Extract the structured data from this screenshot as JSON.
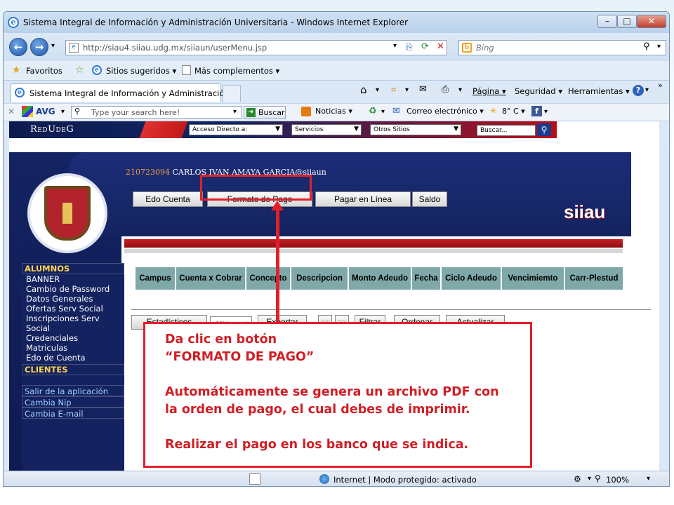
{
  "window": {
    "title": "Sistema Integral de Información y Administración Universitaria - Windows Internet Explorer"
  },
  "address": {
    "url": "http://siau4.siiau.udg.mx/siiaun/userMenu.jsp",
    "search_placeholder": "Bing"
  },
  "favorites": {
    "favoritos": "Favoritos",
    "sitios": "Sitios sugeridos ▾",
    "mas": "Más complementos ▾"
  },
  "tab": {
    "label": "Sistema Integral de Información y Administració..."
  },
  "commands": {
    "pagina": "Página ▾",
    "seguridad": "Seguridad ▾",
    "herramientas": "Herramientas ▾"
  },
  "avg": {
    "logo": "AVG",
    "search_placeholder": "Type your search here!",
    "buscar": "Buscar",
    "noticias": "Noticias ▾",
    "correo": "Correo electrónico ▾",
    "weather": "8° C ▾"
  },
  "site": {
    "brand": "RedUdeG",
    "selects": [
      "Acceso Directo a:",
      "Servicios",
      "Otros Sitios"
    ],
    "search": "Buscar...",
    "user_id": "210723094",
    "user_name": "CARLOS IVAN AMAYA GARCIA@siiaun",
    "siiau_logo": "siiau",
    "tabs": [
      "Edo Cuenta",
      "Formato de Pago",
      "Pagar en Línea",
      "Saldo"
    ]
  },
  "menu": {
    "alumnos": "ALUMNOS",
    "items": [
      "BANNER",
      "Cambio de Password",
      "Datos Generales",
      "Ofertas Serv Social",
      "Inscripciones Serv",
      "Social",
      "Credenciales",
      "Matriculas",
      "Edo de Cuenta"
    ],
    "clientes": "CLIENTES",
    "links": [
      "Salir de la aplicación",
      "Cambia Nip",
      "Cambia E-mail"
    ]
  },
  "table": {
    "headers": [
      "Campus",
      "Cuenta x Cobrar",
      "Concepto",
      "Descripcion",
      "Monto Adeudo",
      "Fecha",
      "Ciclo Adeudo",
      "Vencimiemto",
      "Carr-Plestud"
    ]
  },
  "toolbar": {
    "estadisticos": "Estadísticos",
    "format": "csv",
    "exportar": "Exportar",
    "prev": "<<",
    "next": ">>",
    "filtrar": "Filtrar",
    "ordenar": "Ordenar",
    "actualizar": "Actualizar"
  },
  "annotation": {
    "line1": "Da clic en botón",
    "line2": "“FORMATO DE PAGO”",
    "line3": "Automáticamente se genera un archivo PDF  con",
    "line4": "la orden de pago, el cual debes de imprimir.",
    "line5": "Realizar el pago en los banco que se indica."
  },
  "status": {
    "text": "Internet | Modo protegido: activado",
    "zoom": "100%"
  },
  "colors": {
    "accent_red": "#e3202a",
    "udg_blue": "#14235f",
    "table_header": "#7fa8a8"
  }
}
